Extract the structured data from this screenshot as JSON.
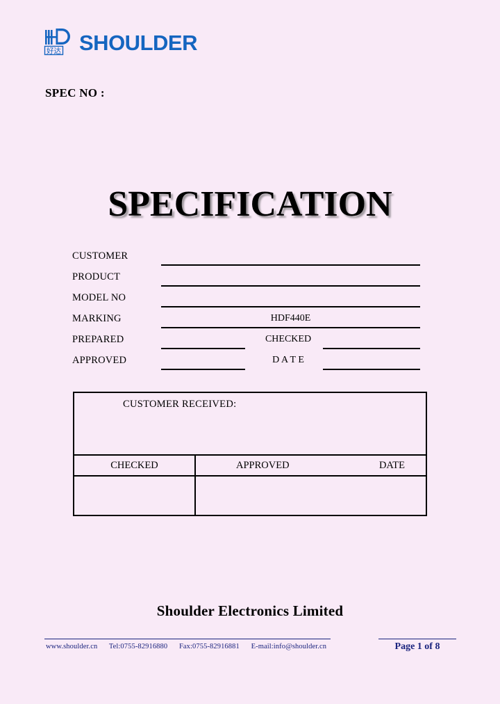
{
  "header": {
    "logo_mark_icon": "hd-monogram-icon",
    "logo_mark_subtext": "好达",
    "logo_wordmark": "SHOULDER",
    "brand_color": "#1565c0",
    "spec_no_label": "SPEC NO :"
  },
  "title": {
    "text": "SPECIFICATION"
  },
  "form": {
    "rows": [
      {
        "label": "CUSTOMER",
        "value": "",
        "line": "full"
      },
      {
        "label": "PRODUCT",
        "value": "",
        "line": "full"
      },
      {
        "label": "MODEL NO",
        "value": "",
        "line": "full"
      },
      {
        "label": "MARKING",
        "value": "HDF440E",
        "line": "full"
      },
      {
        "label": "PREPARED",
        "value": "CHECKED",
        "line": "split"
      },
      {
        "label": "APPROVED",
        "value": "D A T E",
        "line": "split"
      }
    ]
  },
  "received_table": {
    "heading": "CUSTOMER RECEIVED:",
    "columns": [
      "CHECKED",
      "APPROVED",
      "DATE"
    ],
    "body_values": [
      "",
      "",
      ""
    ]
  },
  "company": {
    "name": "Shoulder Electronics Limited"
  },
  "footer": {
    "website": "www.shoulder.cn",
    "tel": "Tel:0755-82916880",
    "fax": "Fax:0755-82916881",
    "email": "E-mail:info@shoulder.cn",
    "page_indicator": "Page 1 of 8",
    "accent_color": "#1a237e"
  }
}
